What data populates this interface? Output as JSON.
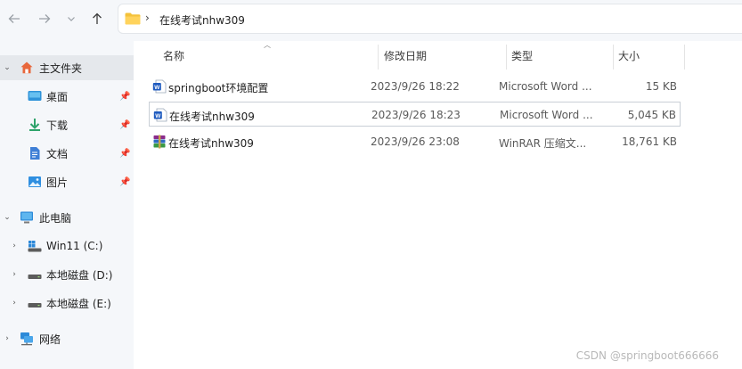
{
  "nav": {
    "back_icon": "arrow-left-icon",
    "forward_icon": "arrow-right-icon",
    "recent_icon": "chevron-down-icon",
    "up_icon": "arrow-up-icon"
  },
  "address": {
    "separator": "›",
    "path": "在线考试nhw309"
  },
  "sidebar": {
    "items": [
      {
        "label": "主文件夹",
        "icon": "home-icon",
        "chevron": "⌄",
        "pinned": false,
        "selected": true
      },
      {
        "label": "桌面",
        "icon": "desktop-icon",
        "pinned": true
      },
      {
        "label": "下载",
        "icon": "download-icon",
        "pinned": true
      },
      {
        "label": "文档",
        "icon": "document-icon",
        "pinned": true
      },
      {
        "label": "图片",
        "icon": "picture-icon",
        "pinned": true
      },
      {
        "label": "此电脑",
        "icon": "computer-icon",
        "chevron": "⌄",
        "pinned": false
      },
      {
        "label": "Win11 (C:)",
        "icon": "windows-drive-icon",
        "chevron": "›",
        "pinned": false
      },
      {
        "label": "本地磁盘 (D:)",
        "icon": "drive-icon",
        "chevron": "›",
        "pinned": false
      },
      {
        "label": "本地磁盘 (E:)",
        "icon": "drive-icon",
        "chevron": "›",
        "pinned": false
      },
      {
        "label": "网络",
        "icon": "network-icon",
        "chevron": "›",
        "pinned": false
      }
    ]
  },
  "columns": {
    "name": "名称",
    "modified": "修改日期",
    "type": "类型",
    "size": "大小"
  },
  "files": [
    {
      "name": "springboot环境配置",
      "modified": "2023/9/26 18:22",
      "type": "Microsoft Word ...",
      "size": "15 KB",
      "icon": "word-doc-icon"
    },
    {
      "name": "在线考试nhw309",
      "modified": "2023/9/26 18:23",
      "type": "Microsoft Word ...",
      "size": "5,045 KB",
      "icon": "word-doc-icon"
    },
    {
      "name": "在线考试nhw309",
      "modified": "2023/9/26 23:08",
      "type": "WinRAR 压缩文...",
      "size": "18,761 KB",
      "icon": "winrar-archive-icon"
    }
  ],
  "watermark": "CSDN @springboot666666"
}
